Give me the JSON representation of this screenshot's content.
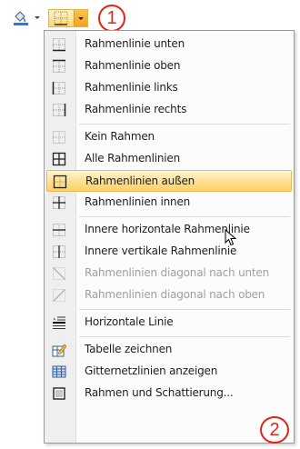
{
  "toolbar": {
    "fill_button_icon": "paint-bucket-icon",
    "border_button_icon": "borders-grid-icon",
    "callout_1": "1"
  },
  "menu": {
    "items": [
      {
        "label": "Rahmenlinie unten",
        "icon": "border-bottom-icon",
        "enabled": true
      },
      {
        "label": "Rahmenlinie oben",
        "icon": "border-top-icon",
        "enabled": true
      },
      {
        "label": "Rahmenlinie links",
        "icon": "border-left-icon",
        "enabled": true
      },
      {
        "label": "Rahmenlinie rechts",
        "icon": "border-right-icon",
        "enabled": true
      },
      {
        "label": "Kein Rahmen",
        "icon": "no-border-icon",
        "enabled": true
      },
      {
        "label": "Alle Rahmenlinien",
        "icon": "all-borders-icon",
        "enabled": true
      },
      {
        "label": "Rahmenlinien außen",
        "icon": "outside-borders-icon",
        "enabled": true,
        "highlighted": true
      },
      {
        "label": "Rahmenlinien innen",
        "icon": "inside-borders-icon",
        "enabled": true
      },
      {
        "label": "Innere horizontale Rahmenlinie",
        "icon": "inside-horizontal-border-icon",
        "enabled": true
      },
      {
        "label": "Innere vertikale Rahmenlinie",
        "icon": "inside-vertical-border-icon",
        "enabled": true
      },
      {
        "label": "Rahmenlinien diagonal nach unten",
        "icon": "diagonal-down-border-icon",
        "enabled": false
      },
      {
        "label": "Rahmenlinien diagonal nach oben",
        "icon": "diagonal-up-border-icon",
        "enabled": false
      },
      {
        "label": "Horizontale Linie",
        "icon": "horizontal-line-icon",
        "enabled": true
      },
      {
        "label": "Tabelle zeichnen",
        "icon": "draw-table-icon",
        "enabled": true
      },
      {
        "label": "Gitternetzlinien anzeigen",
        "icon": "view-gridlines-icon",
        "enabled": true
      },
      {
        "label": "Rahmen und Schattierung...",
        "icon": "borders-and-shading-icon",
        "enabled": true
      }
    ]
  },
  "callout_2": "2",
  "colors": {
    "highlight": "#fde08f",
    "callout": "#e0231a",
    "accent_orange": "#f4a21e"
  }
}
